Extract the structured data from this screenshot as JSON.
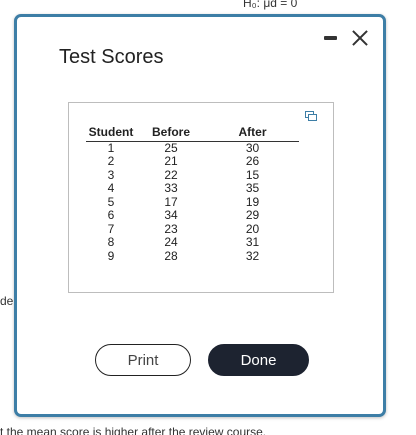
{
  "background": {
    "top_text": "H₀: μd = 0",
    "left_text": "de",
    "bottom_text": "t the mean score is higher after the review course."
  },
  "dialog": {
    "title": "Test Scores",
    "controls": {
      "minimize_icon": "minimize-icon",
      "close_icon": "close-icon"
    },
    "expand_icon": "expand-icon",
    "table": {
      "headers": [
        "Student",
        "Before",
        "After"
      ],
      "rows": [
        [
          "1",
          "25",
          "30"
        ],
        [
          "2",
          "21",
          "26"
        ],
        [
          "3",
          "22",
          "15"
        ],
        [
          "4",
          "33",
          "35"
        ],
        [
          "5",
          "17",
          "19"
        ],
        [
          "6",
          "34",
          "29"
        ],
        [
          "7",
          "23",
          "20"
        ],
        [
          "8",
          "24",
          "31"
        ],
        [
          "9",
          "28",
          "32"
        ]
      ]
    },
    "buttons": {
      "print": "Print",
      "done": "Done"
    }
  },
  "colors": {
    "dialog_border": "#3d7ea6",
    "done_button": "#1d2330",
    "expand_icon": "#3d7ea6"
  }
}
